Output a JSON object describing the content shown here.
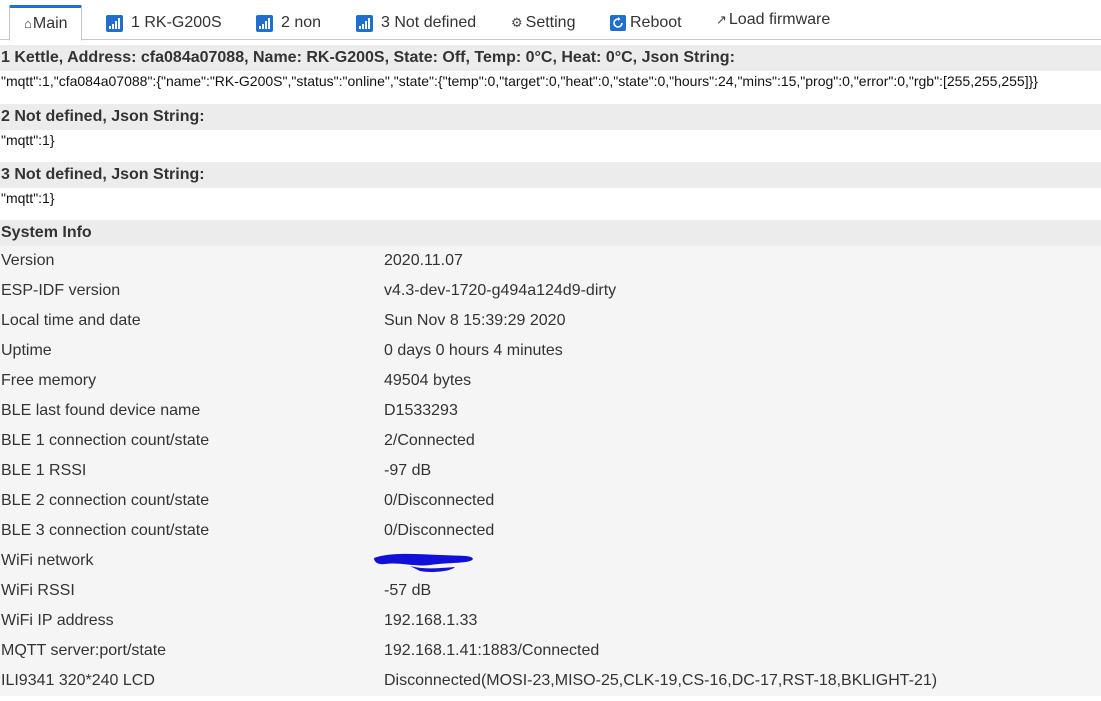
{
  "tabs": [
    {
      "label": "Main",
      "icon": "home-icon",
      "active": true
    },
    {
      "label": "1 RK-G200S",
      "icon": "signal-icon",
      "active": false
    },
    {
      "label": "2 non",
      "icon": "signal-icon",
      "active": false
    },
    {
      "label": "3 Not defined",
      "icon": "signal-icon",
      "active": false
    },
    {
      "label": "Setting",
      "icon": "gear-icon",
      "active": false
    },
    {
      "label": "Reboot",
      "icon": "reboot-icon",
      "active": false
    },
    {
      "label": "Load firmware",
      "icon": "upload-icon",
      "active": false
    }
  ],
  "devices": [
    {
      "header": "1 Kettle, Address: cfa084a07088, Name: RK-G200S, State: Off, Temp: 0°C, Heat: 0°C, Json String:",
      "json": "\"mqtt\":1,\"cfa084a07088\":{\"name\":\"RK-G200S\",\"status\":\"online\",\"state\":{\"temp\":0,\"target\":0,\"heat\":0,\"state\":0,\"hours\":24,\"mins\":15,\"prog\":0,\"error\":0,\"rgb\":[255,255,255]}}"
    },
    {
      "header": "2 Not defined, Json String:",
      "json": "\"mqtt\":1}"
    },
    {
      "header": "3 Not defined, Json String:",
      "json": "\"mqtt\":1}"
    }
  ],
  "system_info": {
    "title": "System Info",
    "rows": [
      {
        "key": "Version",
        "value": "2020.11.07"
      },
      {
        "key": "ESP-IDF version",
        "value": "v4.3-dev-1720-g494a124d9-dirty"
      },
      {
        "key": "Local time and date",
        "value": "Sun Nov 8 15:39:29 2020"
      },
      {
        "key": "Uptime",
        "value": "0 days 0 hours 4 minutes"
      },
      {
        "key": "Free memory",
        "value": "49504 bytes"
      },
      {
        "key": "BLE last found device name",
        "value": "D1533293"
      },
      {
        "key": "BLE 1 connection count/state",
        "value": "2/Connected"
      },
      {
        "key": "BLE 1 RSSI",
        "value": "-97 dB"
      },
      {
        "key": "BLE 2 connection count/state",
        "value": "0/Disconnected"
      },
      {
        "key": "BLE 3 connection count/state",
        "value": "0/Disconnected"
      },
      {
        "key": "WiFi network",
        "value": ""
      },
      {
        "key": "WiFi RSSI",
        "value": "-57 dB"
      },
      {
        "key": "WiFi IP address",
        "value": "192.168.1.33"
      },
      {
        "key": "MQTT server:port/state",
        "value": "192.168.1.41:1883/Connected"
      },
      {
        "key": "ILI9341 320*240 LCD",
        "value": "Disconnected(MOSI-23,MISO-25,CLK-19,CS-16,DC-17,RST-18,BKLIGHT-21)"
      }
    ]
  },
  "colors": {
    "accent": "#1f6fd0",
    "section_bg": "#ececec",
    "info_bg": "#f5f5f5",
    "redaction": "#1010d8"
  }
}
